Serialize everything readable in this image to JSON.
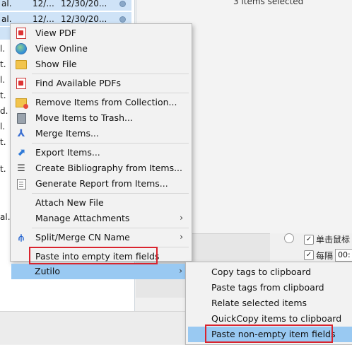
{
  "list": {
    "rows": [
      {
        "c1": "al.",
        "c2": "12/...",
        "c3": "12/30/20...",
        "selected": true
      },
      {
        "c1": "al.",
        "c2": "12/...",
        "c3": "12/30/20...",
        "selected": true
      }
    ],
    "stub_left": [
      "l.",
      "t.",
      "l.",
      "t.",
      "d.",
      "l.",
      "t.",
      "t.",
      "al."
    ]
  },
  "detail": {
    "selection_text": "3 items selected",
    "options": [
      {
        "label": "单击鼠标",
        "checked": true
      },
      {
        "label": "每隔",
        "checked": true
      }
    ],
    "time_value": "00:"
  },
  "context_menu": {
    "items": [
      {
        "label": "View PDF",
        "icon": "pdf-icon"
      },
      {
        "label": "View Online",
        "icon": "globe-icon"
      },
      {
        "label": "Show File",
        "icon": "folder-icon"
      },
      {
        "label": "Find Available PDFs",
        "icon": "pdf-icon"
      },
      {
        "label": "Remove Items from Collection...",
        "icon": "collection-remove-icon"
      },
      {
        "label": "Move Items to Trash...",
        "icon": "trash-icon"
      },
      {
        "label": "Merge Items...",
        "icon": "merge-icon"
      },
      {
        "label": "Export Items...",
        "icon": "export-icon"
      },
      {
        "label": "Create Bibliography from Items...",
        "icon": "list-icon"
      },
      {
        "label": "Generate Report from Items...",
        "icon": "report-icon"
      },
      {
        "label": "Attach New File",
        "icon": ""
      },
      {
        "label": "Manage Attachments",
        "icon": "",
        "submenu": true
      },
      {
        "label": "Split/Merge CN Name",
        "icon": "split-icon",
        "submenu": true
      },
      {
        "label": "Paste into empty item fields",
        "icon": "",
        "highlighted_box": true
      },
      {
        "label": "Zutilo",
        "icon": "",
        "submenu": true,
        "active": true
      }
    ],
    "arrow_glyph": "›"
  },
  "zutilo_submenu": {
    "items": [
      {
        "label": "Copy tags to clipboard"
      },
      {
        "label": "Paste tags from clipboard"
      },
      {
        "label": "Relate selected items"
      },
      {
        "label": "QuickCopy items to clipboard"
      },
      {
        "label": "Paste non-empty item fields",
        "active": true,
        "highlighted_box": true
      }
    ]
  },
  "colors": {
    "highlight": "#99c9f2",
    "annotation_box": "#d9242e",
    "menu_bg": "#f2f2f2"
  }
}
